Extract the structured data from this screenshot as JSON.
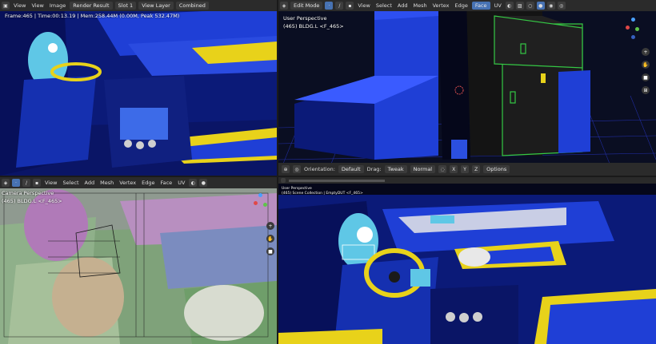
{
  "top_left": {
    "menus": [
      "View",
      "View",
      "Image"
    ],
    "image_name": "Render Result",
    "slot": "Slot 1",
    "layer": "View Layer",
    "pass": "Combined",
    "render_info": "Frame:465 | Time:00:13.19 | Mem:258.44M (0.00M, Peak 532.47M)"
  },
  "top_right": {
    "mode": "Edit Mode",
    "menus": [
      "View",
      "Select",
      "Add",
      "Mesh",
      "Vertex",
      "Edge",
      "Face",
      "UV"
    ],
    "active_menu": "Face",
    "view_label": "User Perspective",
    "object_label": "(465) BLDG.L <F_465>",
    "toolbar": {
      "orientation_label": "Orientation:",
      "orientation_value": "Default",
      "drag_label": "Drag:",
      "drag_value": "Tweak",
      "normal_value": "Normal",
      "axes": [
        "X",
        "Y",
        "Z"
      ],
      "options": "Options"
    }
  },
  "bottom_left": {
    "menus": [
      "View",
      "Select",
      "Add",
      "Mesh",
      "Vertex",
      "Edge",
      "Face",
      "UV"
    ],
    "view_label": "Camera Perspective",
    "object_label": "(465) BLDG.L <F_465>"
  },
  "bottom_right": {
    "view_label": "User Perspective",
    "object_label": "(465) Scene Collection | EmptyDUT <F_465>"
  },
  "colors": {
    "navy": "#0b1a78",
    "blue": "#1f3fd6",
    "yellow": "#e8d21a",
    "teal": "#5fc7e6",
    "accent": "#4772b3"
  }
}
